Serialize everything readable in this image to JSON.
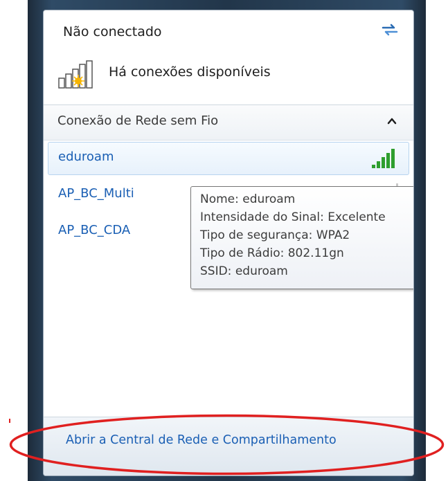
{
  "status": {
    "title": "Não conectado",
    "available_text": "Há conexões disponíveis"
  },
  "section": {
    "label": "Conexão de Rede sem Fio"
  },
  "networks": [
    {
      "name": "eduroam",
      "selected": true,
      "signal_bars": 5
    },
    {
      "name": "AP_BC_Multi",
      "selected": false
    },
    {
      "name": "AP_BC_CDA",
      "selected": false
    }
  ],
  "tooltip": {
    "lines": [
      "Nome: eduroam",
      "Intensidade do Sinal: Excelente",
      "Tipo de segurança: WPA2",
      "Tipo de Rádio: 802.11gn",
      "SSID: eduroam"
    ]
  },
  "footer": {
    "link": "Abrir a Central de Rede e Compartilhamento"
  },
  "colors": {
    "link": "#1a5fb4",
    "signal_green": "#2e9e2e",
    "annotation_red": "#e02020"
  }
}
